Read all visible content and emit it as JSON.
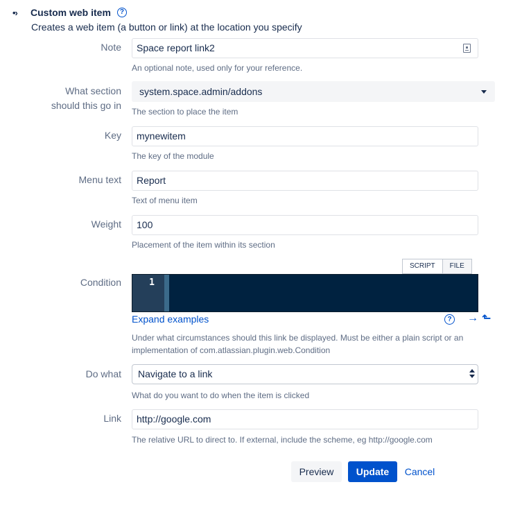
{
  "header": {
    "title": "Custom web item",
    "description": "Creates a web item (a button or link) at the location you specify"
  },
  "fields": {
    "note": {
      "label": "Note",
      "value": "Space report link2",
      "description": "An optional note, used only for your reference."
    },
    "section": {
      "label_line1": "What section",
      "label_line2": "should this go in",
      "value": "system.space.admin/addons",
      "description": "The section to place the item"
    },
    "key": {
      "label": "Key",
      "value": "mynewitem",
      "description": "The key of the module"
    },
    "menu_text": {
      "label": "Menu text",
      "value": "Report",
      "description": "Text of menu item"
    },
    "weight": {
      "label": "Weight",
      "value": "100",
      "description": "Placement of the item within its section"
    },
    "condition": {
      "label": "Condition",
      "tab_script": "SCRIPT",
      "tab_file": "FILE",
      "line_number": "1",
      "expand_link": "Expand examples",
      "description_line1": "Under what circumstances should this link be displayed. Must be either a plain script or an",
      "description_line2": "implementation of com.atlassian.plugin.web.Condition"
    },
    "do_what": {
      "label": "Do what",
      "value": "Navigate to a link",
      "description": "What do you want to do when the item is clicked"
    },
    "link": {
      "label": "Link",
      "value": "http://google.com",
      "description": "The relative URL to direct to. If external, include the scheme, eg http://google.com"
    }
  },
  "buttons": {
    "preview": "Preview",
    "update": "Update",
    "cancel": "Cancel"
  },
  "icons": {
    "bullet": "•›",
    "help": "?",
    "arrow_right": "→",
    "arrow_up": "⬑"
  },
  "colors": {
    "accent": "#0052cc",
    "editor_bg": "#002240",
    "label": "#5e6c84"
  }
}
